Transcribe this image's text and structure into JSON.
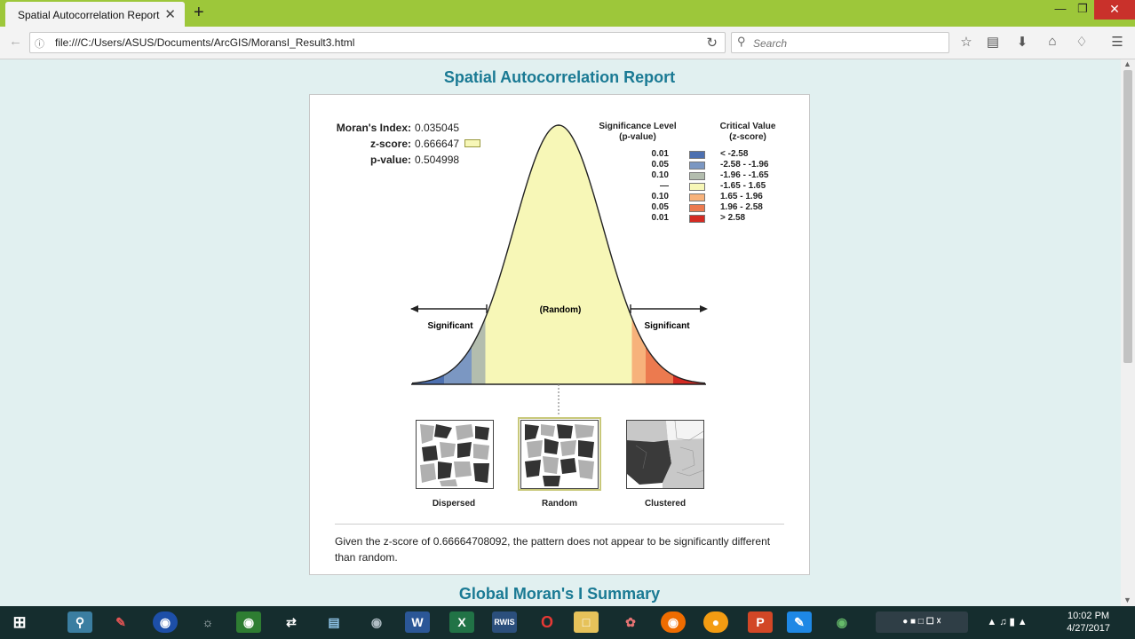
{
  "browser": {
    "tab_title": "Spatial Autocorrelation Report",
    "tab_close": "✕",
    "new_tab": "+",
    "url": "file:///C:/Users/ASUS/Documents/ArcGIS/MoransI_Result3.html",
    "search_placeholder": "Search",
    "window_controls": {
      "minimize": "—",
      "restore": "❐",
      "close": "✕"
    }
  },
  "report": {
    "title": "Spatial Autocorrelation Report",
    "stats": [
      {
        "label": "Moran's Index:",
        "value": "0.035045"
      },
      {
        "label": "z-score:",
        "value": "0.666647"
      },
      {
        "label": "p-value:",
        "value": "0.504998"
      }
    ],
    "legend": {
      "sig_header_1": "Significance Level",
      "sig_header_2": "(p-value)",
      "crit_header_1": "Critical Value",
      "crit_header_2": "(z-score)",
      "rows": [
        {
          "p": "0.01",
          "z": "< -2.58",
          "color": "#4d70b0"
        },
        {
          "p": "0.05",
          "z": "-2.58 - -1.96",
          "color": "#7b97c2"
        },
        {
          "p": "0.10",
          "z": "-1.96 - -1.65",
          "color": "#b3bdae"
        },
        {
          "p": "---",
          "z": "-1.65 - 1.65",
          "color": "#f7f7b7"
        },
        {
          "p": "0.10",
          "z": "1.65 - 1.96",
          "color": "#f7b27b"
        },
        {
          "p": "0.05",
          "z": "1.96 - 2.58",
          "color": "#ec7a4f"
        },
        {
          "p": "0.01",
          "z": "> 2.58",
          "color": "#d42a22"
        }
      ]
    },
    "curve_labels": {
      "random": "(Random)",
      "significant_left": "Significant",
      "significant_right": "Significant"
    },
    "maps": [
      {
        "label": "Dispersed"
      },
      {
        "label": "Random"
      },
      {
        "label": "Clustered"
      }
    ],
    "interpretation": "Given the z-score of 0.66664708092, the pattern does not appear to be significantly different than random.",
    "summary_title": "Global Moran's I Summary"
  },
  "chart_data": {
    "type": "area",
    "title": "",
    "xlabel": "",
    "ylabel": "",
    "distribution": "standard normal",
    "x_range": [
      -3.3,
      3.3
    ],
    "bands": [
      {
        "from": -3.3,
        "to": -2.58,
        "color": "#4d70b0"
      },
      {
        "from": -2.58,
        "to": -1.96,
        "color": "#7b97c2"
      },
      {
        "from": -1.96,
        "to": -1.65,
        "color": "#b3bdae"
      },
      {
        "from": -1.65,
        "to": 1.65,
        "color": "#f7f7b7"
      },
      {
        "from": 1.65,
        "to": 1.96,
        "color": "#f7b27b"
      },
      {
        "from": 1.96,
        "to": 2.58,
        "color": "#ec7a4f"
      },
      {
        "from": 2.58,
        "to": 3.3,
        "color": "#d42a22"
      }
    ],
    "marker_z": 0.0
  },
  "taskbar": {
    "time": "10:02 PM",
    "date": "4/27/2017"
  }
}
